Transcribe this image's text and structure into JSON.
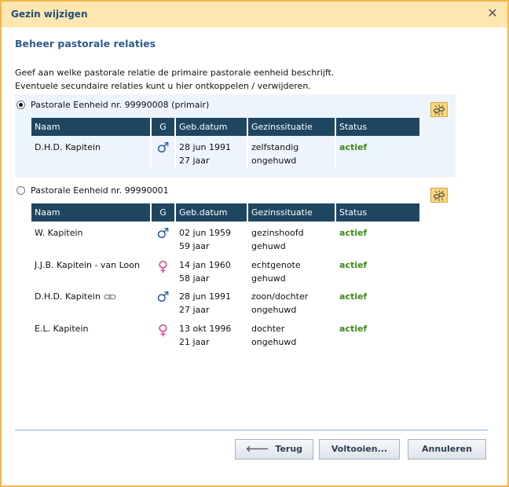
{
  "window": {
    "title": "Gezin wijzigen"
  },
  "section": {
    "title": "Beheer pastorale relaties"
  },
  "intro": {
    "line1": "Geef aan welke pastorale relatie de primaire pastorale eenheid beschrijft.",
    "line2": "Eventuele secundaire relaties kunt u hier ontkoppelen / verwijderen."
  },
  "columns": {
    "naam": "Naam",
    "g": "G",
    "geb": "Geb.datum",
    "gezin": "Gezinssituatie",
    "status": "Status"
  },
  "units": [
    {
      "label": "Pastorale Eenheid nr. 99990008 (primair)",
      "selected": true,
      "members": [
        {
          "name": "D.H.D. Kapitein",
          "gender": "male",
          "date": "28 jun 1991",
          "age": "27 jaar",
          "situation": "zelfstandig",
          "marital": "ongehuwd",
          "status": "actief"
        }
      ]
    },
    {
      "label": "Pastorale Eenheid nr. 99990001",
      "selected": false,
      "members": [
        {
          "name": "W. Kapitein",
          "gender": "male",
          "date": "02 jun 1959",
          "age": "59 jaar",
          "situation": "gezinshoofd",
          "marital": "gehuwd",
          "status": "actief"
        },
        {
          "name": "J.J.B. Kapitein - van Loon",
          "gender": "female",
          "date": "14 jan 1960",
          "age": "58 jaar",
          "situation": "echtgenote",
          "marital": "gehuwd",
          "status": "actief"
        },
        {
          "name": "D.H.D. Kapitein",
          "gender": "male",
          "date": "28 jun 1991",
          "age": "27 jaar",
          "situation": "zoon/dochter",
          "marital": "ongehuwd",
          "status": "actief",
          "linked": true
        },
        {
          "name": "E.L. Kapitein",
          "gender": "female",
          "date": "13 okt 1996",
          "age": "21 jaar",
          "situation": "dochter",
          "marital": "ongehuwd",
          "status": "actief"
        }
      ]
    }
  ],
  "buttons": {
    "back": "Terug",
    "finish": "Voltooien...",
    "cancel": "Annuleren"
  },
  "icons": {
    "close": "close-icon",
    "unlink": "unlink-icon",
    "male": "male-icon",
    "female": "female-icon",
    "chain": "chain-link-icon",
    "back_arrow": "arrow-left-icon"
  },
  "colors": {
    "accent_border": "#f2b64f",
    "titlebar": "#fde6b0",
    "table_header": "#1f4660",
    "status_active": "#3c8a15",
    "male": "#2b5da8",
    "female": "#e4408a",
    "primary_group_bg": "#eef4fb"
  }
}
